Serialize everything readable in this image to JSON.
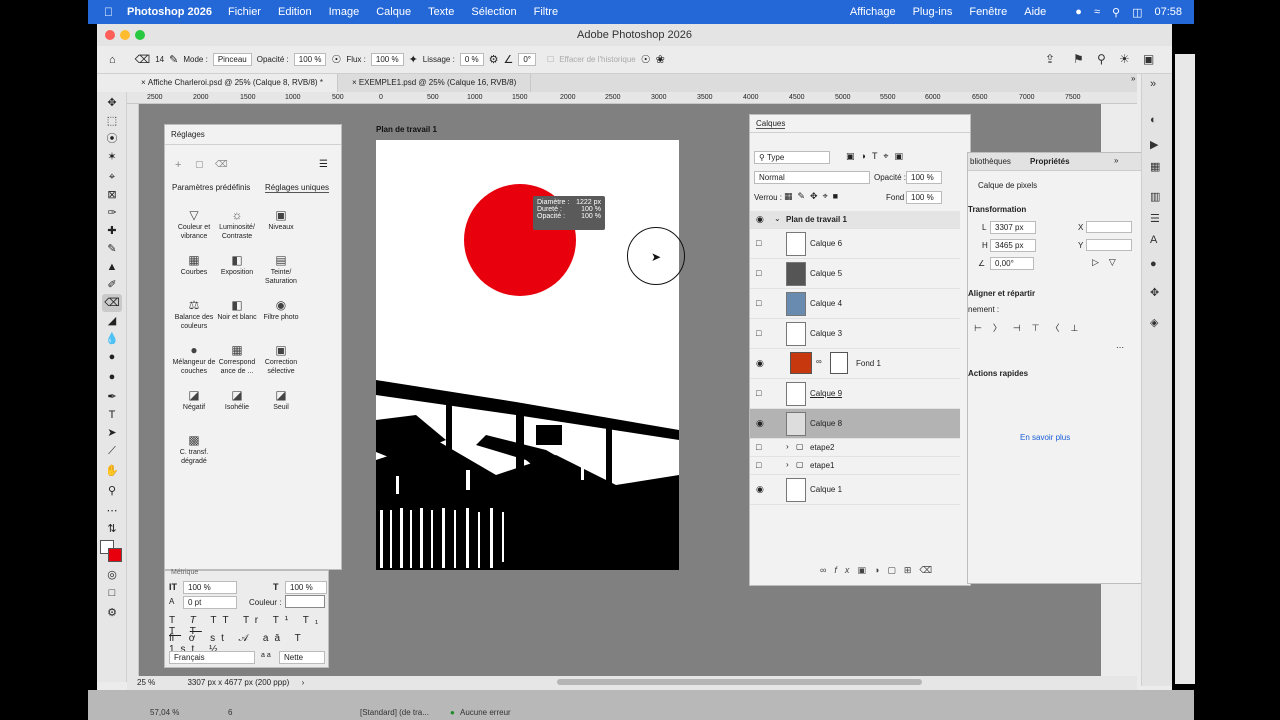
{
  "menubar": {
    "app": "Photoshop 2026",
    "items": [
      "Fichier",
      "Edition",
      "Image",
      "Calque",
      "Texte",
      "Sélection",
      "Filtre"
    ],
    "right_items": [
      "Affichage",
      "Plug-ins",
      "Fenêtre",
      "Aide"
    ],
    "clock": "07:58"
  },
  "window": {
    "title": "Adobe Photoshop 2026"
  },
  "options": {
    "brush_size": "14",
    "mode_label": "Mode :",
    "mode_value": "Pinceau",
    "opacity_label": "Opacité :",
    "opacity_value": "100 %",
    "flux_label": "Flux :",
    "flux_value": "100 %",
    "lissage_label": "Lissage :",
    "lissage_value": "0 %",
    "angle_value": "0°",
    "history_label": "Effacer de l'historique"
  },
  "tabs": [
    {
      "label": "Affiche Charleroi.psd @ 25% (Calque 8, RVB/8) *"
    },
    {
      "label": "EXEMPLE1.psd @ 25% (Calque 16, RVB/8)"
    }
  ],
  "ruler_h": [
    "2500",
    "2000",
    "1500",
    "1000",
    "500",
    "0",
    "500",
    "1000",
    "1500",
    "2000",
    "2500",
    "3000",
    "3500",
    "4000",
    "4500",
    "5000",
    "5500",
    "6000",
    "6500",
    "7000",
    "7500"
  ],
  "artboard": {
    "label": "Plan de travail 1",
    "circle_color": "#e8000d"
  },
  "tooltip": {
    "diam_label": "Diamètre :",
    "diam_value": "1222 px",
    "dur_label": "Dureté :",
    "dur_value": "100 %",
    "op_label": "Opacité :",
    "op_value": "100 %"
  },
  "adjustments": {
    "title": "Réglages",
    "tab1": "Paramètres prédéfinis",
    "tab2": "Réglages uniques",
    "items": [
      "Couleur et vibrance",
      "Luminosité/ Contraste",
      "Niveaux",
      "Courbes",
      "Exposition",
      "Teinte/ Saturation",
      "Balance des couleurs",
      "Noir et blanc",
      "Filtre photo",
      "Mélangeur de couches",
      "Correspond ance de ...",
      "Correction sélective",
      "Négatif",
      "Isohélie",
      "Seuil",
      "C. transf. dégradé"
    ]
  },
  "character": {
    "scale_v": "100 %",
    "scale_h": "100 %",
    "baseline": "0 pt",
    "color_label": "Couleur :",
    "language": "Français",
    "aa_label": "a a",
    "aa_value": "Nette",
    "metrics": "Métrique"
  },
  "layers": {
    "title": "Calques",
    "filter": "Type",
    "blend": "Normal",
    "opacity_label": "Opacité :",
    "opacity_value": "100 %",
    "lock_label": "Verrou :",
    "fill_label": "Fond :",
    "fill_value": "100 %",
    "artboard": "Plan de travail 1",
    "rows": [
      "Calque 6",
      "Calque 5",
      "Calque 4",
      "Calque 3",
      "Fond 1",
      "Calque 9",
      "Calque 8",
      "etape2",
      "etape1",
      "Calque 1"
    ],
    "fill_color": "#c8380f"
  },
  "properties": {
    "tab1": "bliothèques",
    "tab2": "Propriétés",
    "kind": "Calque de pixels",
    "transform": "Transformation",
    "w_label": "L",
    "w_value": "3307 px",
    "h_label": "H",
    "h_value": "3465 px",
    "x_label": "X",
    "y_label": "Y",
    "angle": "0,00°",
    "align": "Aligner et répartir",
    "align_sub": "nement :",
    "quick": "Actions rapides",
    "learn": "En savoir plus"
  },
  "status": {
    "zoom": "25 %",
    "info": "3307 px x 4677 px (200 ppp)"
  },
  "bottom": {
    "left": "57,04 %",
    "mid": "6",
    "std": "[Standard] (de tra...",
    "err": "Aucune erreur"
  }
}
